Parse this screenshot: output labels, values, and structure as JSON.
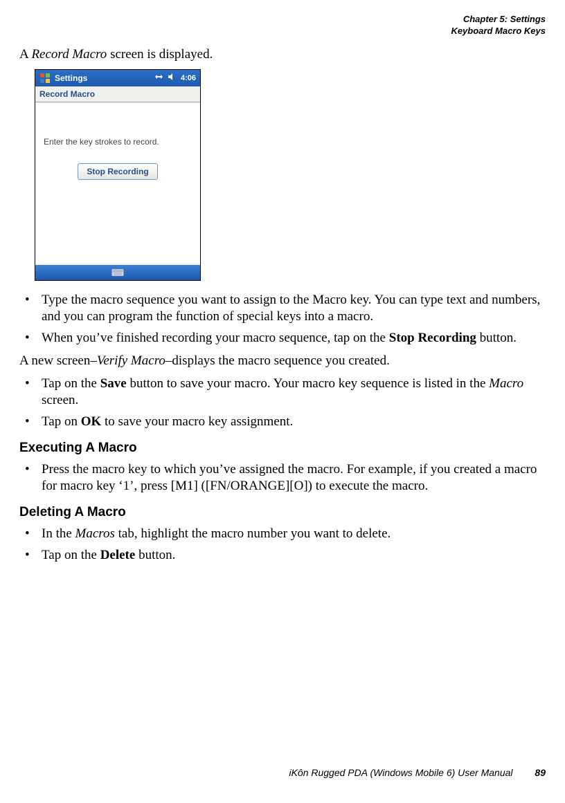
{
  "header": {
    "chapter": "Chapter 5:  Settings",
    "section": "Keyboard Macro Keys"
  },
  "intro": {
    "prefix": "A ",
    "italic": "Record Macro",
    "suffix": " screen is displayed."
  },
  "screenshot": {
    "topbar_title": "Settings",
    "clock": "4:06",
    "subbar": "Record Macro",
    "instruction": "Enter the key strokes to record.",
    "button": "Stop Recording"
  },
  "list1": {
    "item1": "Type the macro sequence you want to assign to the Macro key. You can type text and numbers, and you can program the function of special keys into a macro.",
    "item2_a": "When you’ve finished recording your macro sequence, tap on the ",
    "item2_bold": "Stop Recording",
    "item2_b": " button."
  },
  "para1": {
    "a": "A new screen–",
    "italic": "Verify Macro",
    "b": "–displays the macro sequence you created."
  },
  "list2": {
    "item1_a": "Tap on the ",
    "item1_bold": "Save",
    "item1_b": " button to save your macro. Your macro key sequence is listed in the ",
    "item1_italic": "Macro",
    "item1_c": " screen.",
    "item2_a": "Tap on ",
    "item2_bold": "OK",
    "item2_b": " to save your macro key assignment."
  },
  "heading1": "Executing A Macro",
  "list3": {
    "item1": "Press the macro key to which you’ve assigned the macro. For example, if you created a macro for macro key ‘1’, press [M1] ([FN/ORANGE][O]) to execute the macro."
  },
  "heading2": "Deleting A Macro",
  "list4": {
    "item1_a": "In the ",
    "item1_italic": "Macros",
    "item1_b": " tab, highlight the macro number you want to delete.",
    "item2_a": "Tap on the ",
    "item2_bold": "Delete",
    "item2_b": " button."
  },
  "footer": {
    "title": "iKôn Rugged PDA (Windows Mobile 6) User Manual",
    "page": "89"
  }
}
